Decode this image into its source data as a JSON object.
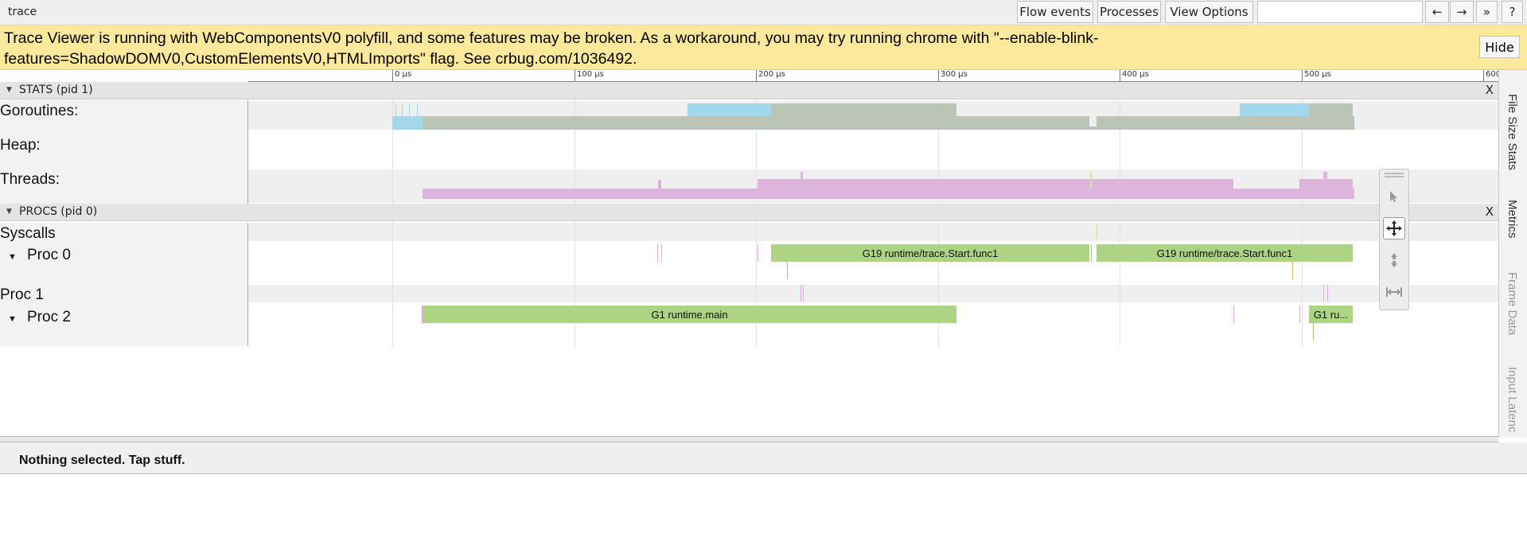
{
  "window": {
    "title": "trace"
  },
  "toolbar": {
    "flow_events": "Flow events",
    "processes": "Processes",
    "view_options": "View Options",
    "search_placeholder": "",
    "prev_label": "←",
    "next_label": "→",
    "more_label": "»",
    "help_label": "?"
  },
  "warning": {
    "text": "Trace Viewer is running with WebComponentsV0 polyfill, and some features may be broken. As a workaround, you may try running chrome with \"--enable-blink-features=ShadowDOMV0,CustomElementsV0,HTMLImports\" flag. See crbug.com/1036492.",
    "hide_label": "Hide"
  },
  "ruler": {
    "labels": [
      "0 µs",
      "100 µs",
      "200 µs",
      "300 µs",
      "400 µs",
      "500 µs",
      "600"
    ]
  },
  "stats": {
    "header": "STATS (pid 1)",
    "close": "X",
    "tracks": [
      "Goroutines:",
      "Heap:",
      "Threads:"
    ]
  },
  "procs": {
    "header": "PROCS (pid 0)",
    "close": "X",
    "tracks": [
      "Syscalls",
      "Proc 0",
      "Proc 1",
      "Proc 2"
    ],
    "slices": {
      "p0_a": "G19 runtime/trace.Start.func1",
      "p0_b": "G19 runtime/trace.Start.func1",
      "p2_a": "G1 runtime.main",
      "p2_b": "G1 ru..."
    }
  },
  "colors": {
    "goroutine_grey": "#bbc5b5",
    "goroutine_blue": "#a3d8ec",
    "thread_pink": "#dcb4dc",
    "slice_green": "#acd484",
    "warning_bg": "#fde99c"
  },
  "sidebar": {
    "tabs": [
      "File Size Stats",
      "Metrics",
      "Frame Data",
      "Input Latenc"
    ]
  },
  "tools": [
    "select-icon",
    "pan-icon",
    "zoom-icon",
    "timing-icon"
  ],
  "status": "Nothing selected. Tap stuff."
}
